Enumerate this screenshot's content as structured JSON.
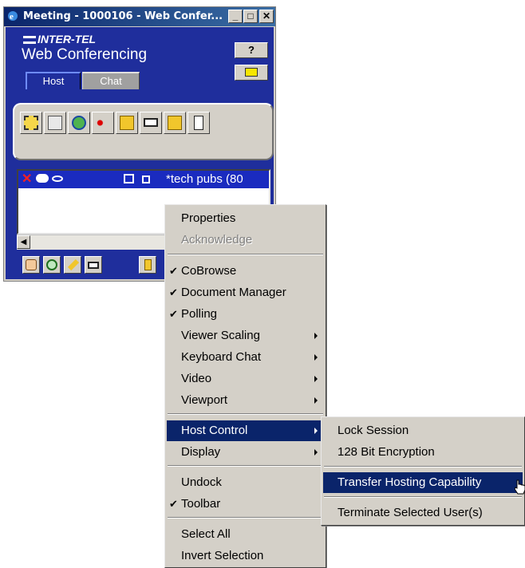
{
  "window": {
    "title": "Meeting - 1000106 - Web Confer...",
    "controls": {
      "minimize": "_",
      "maximize": "□",
      "close": "✕"
    }
  },
  "header": {
    "brand": "INTER-TEL",
    "subtitle": "Web Conferencing",
    "help_label": "?"
  },
  "tabs": [
    {
      "label": "Host",
      "active": true
    },
    {
      "label": "Chat",
      "active": false
    }
  ],
  "toolbar": {
    "icons": [
      "whiteboard-icon",
      "document-tree-icon",
      "cobrowse-icon",
      "record-play-icon",
      "open-folder-icon",
      "camera-icon",
      "folder-icon",
      "poll-icon"
    ]
  },
  "user_list": {
    "rows": [
      {
        "name": "*tech pubs  (80"
      }
    ]
  },
  "bottom_toolbar": {
    "icons": [
      "hand-icon",
      "eye-icon",
      "pencil-icon",
      "video-icon",
      "door-icon"
    ]
  },
  "context_menu": {
    "items": [
      {
        "label": "Properties",
        "checked": false,
        "disabled": false,
        "submenu": false
      },
      {
        "label": "Acknowledge",
        "checked": false,
        "disabled": true,
        "submenu": false
      },
      {
        "label": "CoBrowse",
        "checked": true,
        "disabled": false,
        "submenu": false
      },
      {
        "label": "Document Manager",
        "checked": true,
        "disabled": false,
        "submenu": false
      },
      {
        "label": "Polling",
        "checked": true,
        "disabled": false,
        "submenu": false
      },
      {
        "label": "Viewer Scaling",
        "checked": false,
        "disabled": false,
        "submenu": true
      },
      {
        "label": "Keyboard Chat",
        "checked": false,
        "disabled": false,
        "submenu": true
      },
      {
        "label": "Video",
        "checked": false,
        "disabled": false,
        "submenu": true
      },
      {
        "label": "Viewport",
        "checked": false,
        "disabled": false,
        "submenu": true
      },
      {
        "label": "Host Control",
        "checked": false,
        "disabled": false,
        "submenu": true,
        "highlighted": true
      },
      {
        "label": "Display",
        "checked": false,
        "disabled": false,
        "submenu": true
      },
      {
        "label": "Undock",
        "checked": false,
        "disabled": false,
        "submenu": false
      },
      {
        "label": "Toolbar",
        "checked": true,
        "disabled": false,
        "submenu": false
      },
      {
        "label": "Select All",
        "checked": false,
        "disabled": false,
        "submenu": false
      },
      {
        "label": "Invert Selection",
        "checked": false,
        "disabled": false,
        "submenu": false
      }
    ],
    "check_glyph": "✔"
  },
  "host_control_submenu": {
    "items": [
      {
        "label": "Lock Session"
      },
      {
        "label": "128 Bit Encryption"
      },
      {
        "label": "Transfer Hosting Capability",
        "highlighted": true
      },
      {
        "label": "Terminate Selected User(s)"
      }
    ]
  },
  "colors": {
    "panel_blue": "#1f2e9c",
    "menu_highlight": "#0a246a",
    "menu_bg": "#d4d0c8"
  }
}
